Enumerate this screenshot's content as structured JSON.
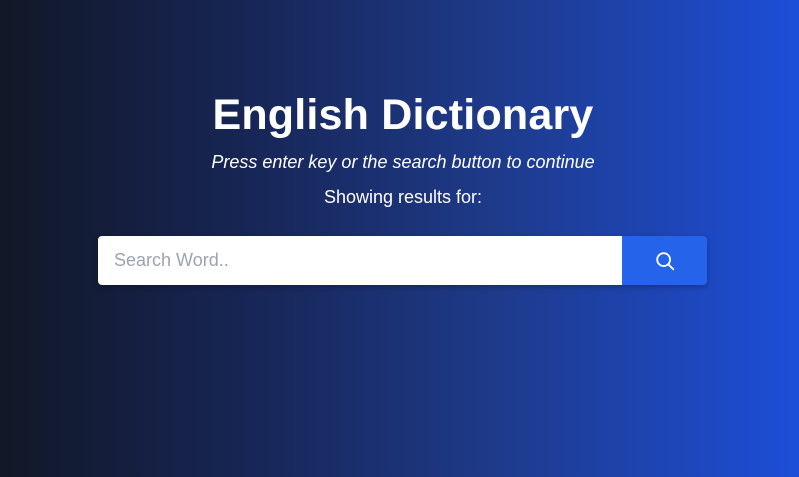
{
  "header": {
    "title": "English Dictionary",
    "subtitle": "Press enter key or the search button to continue",
    "results_label": "Showing results for:"
  },
  "search": {
    "value": "",
    "placeholder": "Search Word..",
    "button_icon": "search-icon"
  },
  "colors": {
    "background_start": "#111827",
    "background_end": "#1d4ed8",
    "button": "#2563eb",
    "text": "#ffffff",
    "placeholder": "#9ca3af"
  }
}
